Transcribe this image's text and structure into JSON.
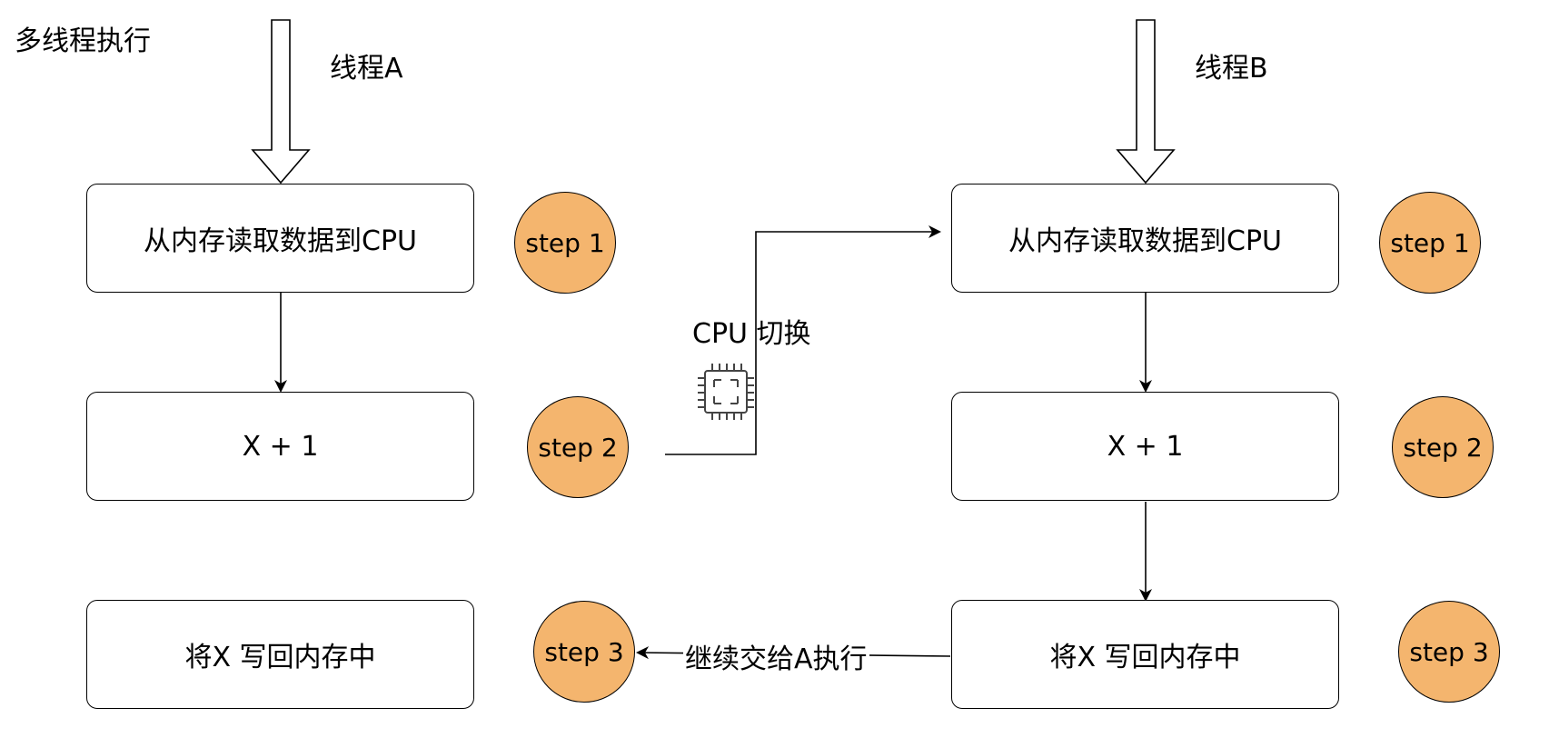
{
  "title": "多线程执行",
  "thread_a": {
    "label": "线程A",
    "steps": [
      {
        "text": "从内存读取数据到CPU",
        "badge": "step 1"
      },
      {
        "text": "X + 1",
        "badge": "step 2"
      },
      {
        "text": "将X 写回内存中",
        "badge": "step 3"
      }
    ]
  },
  "thread_b": {
    "label": "线程B",
    "steps": [
      {
        "text": "从内存读取数据到CPU",
        "badge": "step 1"
      },
      {
        "text": "X + 1",
        "badge": "step 2"
      },
      {
        "text": "将X 写回内存中",
        "badge": "step 3"
      }
    ]
  },
  "edges": {
    "cpu_switch": "CPU 切换",
    "continue_a": "继续交给A执行"
  },
  "colors": {
    "badge_fill": "#f4b56e",
    "stroke": "#000000"
  },
  "icons": {
    "cpu": "cpu-chip-icon"
  }
}
